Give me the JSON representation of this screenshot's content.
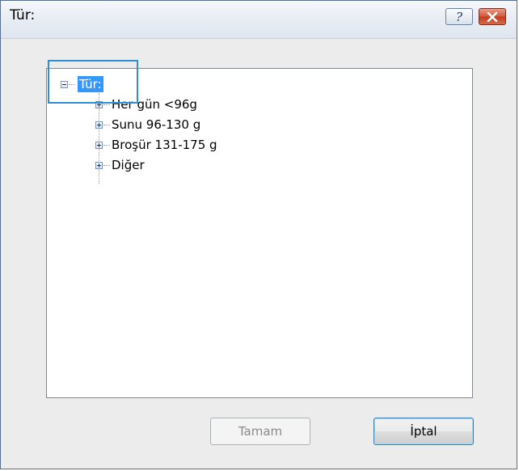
{
  "window": {
    "title": "Tür:",
    "help_glyph": "?",
    "close_glyph": "✕"
  },
  "tree": {
    "root": {
      "label": "Tür:",
      "expanded": true,
      "selected": true
    },
    "children": [
      {
        "label": "Her gün <96g",
        "expanded": false
      },
      {
        "label": "Sunu 96-130 g",
        "expanded": false
      },
      {
        "label": "Broşür 131-175 g",
        "expanded": false
      },
      {
        "label": "Diğer",
        "expanded": false
      }
    ]
  },
  "buttons": {
    "ok_label": "Tamam",
    "ok_enabled": false,
    "cancel_label": "İptal"
  },
  "colors": {
    "selection": "#3399ff",
    "callout": "#2f8fd6",
    "close_button": "#c23d1f"
  }
}
